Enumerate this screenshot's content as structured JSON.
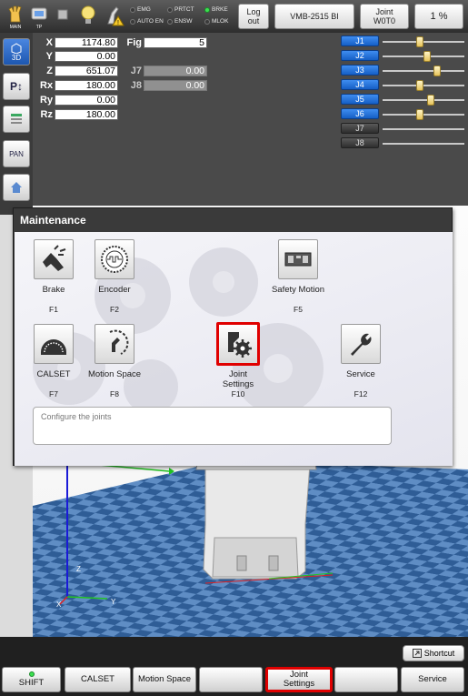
{
  "topbar": {
    "icons": [
      {
        "name": "main-icon",
        "label": "MAIN"
      },
      {
        "name": "tp-icon",
        "label": "TP"
      },
      {
        "name": "stop-icon",
        "label": ""
      },
      {
        "name": "lightbulb-icon",
        "label": ""
      },
      {
        "name": "robot-warning-icon",
        "label": ""
      }
    ],
    "status": {
      "emg": "EMG",
      "auto_en": "AUTO EN",
      "prtct": "PRTCT",
      "ensw": "ENSW",
      "brke": "BRKE",
      "mlok": "MLOK"
    },
    "logout_line1": "Log",
    "logout_line2": "out",
    "robot_model": "VMB-2515 BI",
    "joint_line1": "Joint",
    "joint_line2": "W0T0",
    "speed": "1 %"
  },
  "lefttools": {
    "view3d": "3D",
    "pan": "PAN"
  },
  "coords": {
    "x_label": "X",
    "x": "1174.80",
    "y_label": "Y",
    "y": "0.00",
    "z_label": "Z",
    "z": "651.07",
    "rx_label": "Rx",
    "rx": "180.00",
    "ry_label": "Ry",
    "ry": "0.00",
    "rz_label": "Rz",
    "rz": "180.00",
    "fig_label": "Fig",
    "fig": "5",
    "j7_label": "J7",
    "j7": "0.00",
    "j8_label": "J8",
    "j8": "0.00"
  },
  "joints": [
    {
      "label": "J1",
      "enabled": true,
      "level": 0.45
    },
    {
      "label": "J2",
      "enabled": true,
      "level": 0.55
    },
    {
      "label": "J3",
      "enabled": true,
      "level": 0.68
    },
    {
      "label": "J4",
      "enabled": true,
      "level": 0.45
    },
    {
      "label": "J5",
      "enabled": true,
      "level": 0.6
    },
    {
      "label": "J6",
      "enabled": true,
      "level": 0.45
    },
    {
      "label": "J7",
      "enabled": false
    },
    {
      "label": "J8",
      "enabled": false
    }
  ],
  "viewport": {
    "axis_z": "Z",
    "axis_x": "X",
    "axis_y": "Y"
  },
  "dialog": {
    "title": "Maintenance",
    "items": {
      "brake": {
        "label": "Brake",
        "key": "F1"
      },
      "encoder": {
        "label": "Encoder",
        "key": "F2"
      },
      "safety": {
        "label": "Safety Motion",
        "key": "F5"
      },
      "calset": {
        "label": "CALSET",
        "key": "F7"
      },
      "motion_space": {
        "label": "Motion Space",
        "key": "F8"
      },
      "joint_settings": {
        "label_line1": "Joint",
        "label_line2": "Settings",
        "key": "F10"
      },
      "service": {
        "label": "Service",
        "key": "F12"
      }
    },
    "description": "Configure the joints"
  },
  "bottom": {
    "shortcut": "Shortcut",
    "shift": "SHIFT",
    "calset": "CALSET",
    "motion_space": "Motion Space",
    "joint_settings_line1": "Joint",
    "joint_settings_line2": "Settings",
    "service": "Service"
  }
}
